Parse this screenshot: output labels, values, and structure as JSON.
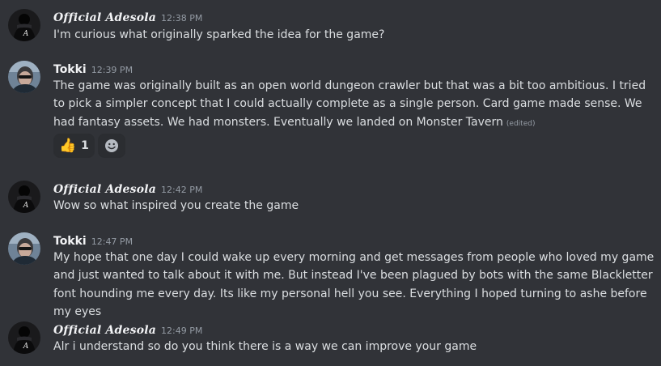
{
  "messages": [
    {
      "author": "Official Adesola",
      "timestamp": "12:38 PM",
      "text": "I'm curious what originally sparked the idea for the game?"
    },
    {
      "author": "Tokki",
      "timestamp": "12:39 PM",
      "text": "The game was originally built as an open world dungeon crawler but that was a bit too ambitious. I tried to pick a simpler concept that I could actually complete as a single person. Card game made sense. We had fantasy assets. We had monsters. Eventually we landed on Monster Tavern",
      "edited_label": "(edited)",
      "reactions": [
        {
          "emoji": "👍",
          "count": "1"
        }
      ]
    },
    {
      "author": "Official Adesola",
      "timestamp": "12:42 PM",
      "text": "Wow so what inspired you create the game"
    },
    {
      "author": "Tokki",
      "timestamp": "12:47 PM",
      "text": "My hope that one day I could wake up every morning and get messages from people who loved my game and just wanted to talk about it with me. But instead I've been plagued by bots with the same Blackletter font hounding me every day. Its like my personal hell you see. Everything I hoped turning to ashe before my eyes"
    },
    {
      "author": "Official Adesola",
      "timestamp": "12:49 PM",
      "text": "Alr i understand so do you think there is a way we can improve your game"
    }
  ],
  "icons": {
    "add_reaction": "smiley-face-icon",
    "avatar_adesola": "dark-figure-avatar",
    "avatar_tokki": "sunglasses-avatar"
  },
  "colors": {
    "background": "#313338",
    "text": "#dbdee1",
    "muted": "#949ba4",
    "username": "#f2f3f5",
    "reaction_bg": "#2b2d31"
  }
}
